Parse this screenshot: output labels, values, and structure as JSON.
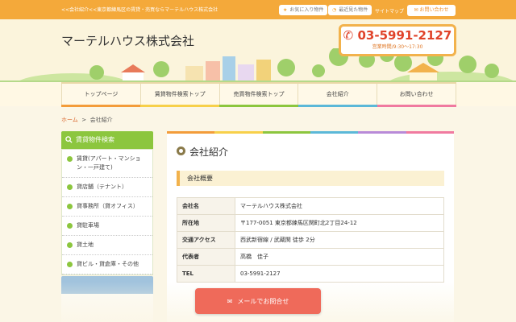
{
  "topbar": {
    "tagline": "<<会社紹介<<東京都練馬区の賃貸・売買ならマーテルハウス株式会社",
    "favorites_label": "お気に入り物件",
    "recent_label": "最近見た物件",
    "sitemap_label": "サイトマップ",
    "contact_label": "お問い合わせ"
  },
  "header": {
    "company_name": "マーテルハウス株式会社",
    "phone": "03-5991-2127",
    "hours": "営業時間/9:30〜17:30"
  },
  "nav": {
    "items": [
      "トップページ",
      "賃貸物件検索トップ",
      "売買物件検索トップ",
      "会社紹介",
      "お問い合わせ"
    ]
  },
  "breadcrumb": {
    "home": "ホーム",
    "separator": ">",
    "current": "会社紹介"
  },
  "sidebar": {
    "heading": "賃貸物件検索",
    "items": [
      "賃貸(アパート・マンション・一戸建て)",
      "貸店舗（テナント）",
      "貸事務所（貸オフィス）",
      "貸駐車場",
      "貸土地",
      "貸ビル・貸倉庫・その他"
    ]
  },
  "main": {
    "title": "会社紹介",
    "section_title": "会社概要",
    "rows": [
      {
        "label": "会社名",
        "value": "マーテルハウス株式会社"
      },
      {
        "label": "所在地",
        "value": "〒177-0051 東京都練馬区関町北2丁目24-12"
      },
      {
        "label": "交通アクセス",
        "value": "西武新宿線 / 武蔵関 徒歩 2分"
      },
      {
        "label": "代表者",
        "value": "高橋　佳子"
      },
      {
        "label": "TEL",
        "value": "03-5991-2127"
      }
    ]
  },
  "mail_button": {
    "label": "メールでお問合せ"
  },
  "colors": {
    "accent_orange": "#f4a93a",
    "phone_red": "#e0432a",
    "sidebar_green": "#8cc63e",
    "mail_button": "#ef6a5a"
  },
  "stripe_colors": [
    "#f39c3a",
    "#f7d04a",
    "#8cc63e",
    "#5bb8d8",
    "#b88ad8",
    "#f07aa0"
  ]
}
